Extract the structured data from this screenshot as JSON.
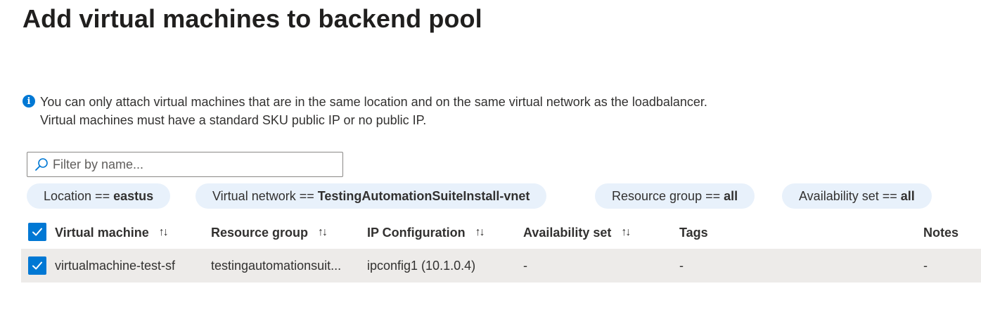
{
  "title": "Add virtual machines to backend pool",
  "info": {
    "icon": "info-icon",
    "line1": "You can only attach virtual machines that are in the same location and on the same virtual network as the loadbalancer.",
    "line2": "Virtual machines must have a standard SKU public IP or no public IP."
  },
  "filter": {
    "placeholder": "Filter by name...",
    "value": ""
  },
  "pills": [
    {
      "label": "Location == ",
      "value": "eastus"
    },
    {
      "label": "Virtual network == ",
      "value": "TestingAutomationSuiteInstall-vnet"
    },
    {
      "label": "Resource group == ",
      "value": "all"
    },
    {
      "label": "Availability set == ",
      "value": "all"
    }
  ],
  "table": {
    "select_all_checked": true,
    "columns": [
      "Virtual machine",
      "Resource group",
      "IP Configuration",
      "Availability set",
      "Tags",
      "Notes"
    ],
    "sort_glyph": "↑↓",
    "rows": [
      {
        "checked": true,
        "vm": "virtualmachine-test-sf",
        "resource_group": "testingautomationsuit...",
        "ip_config": "ipconfig1 (10.1.0.4)",
        "availability_set": "-",
        "tags": "-",
        "notes": "-"
      }
    ]
  },
  "colors": {
    "accent": "#0078d4",
    "pill_bg": "#e8f1fb",
    "row_bg": "#edebe9"
  }
}
